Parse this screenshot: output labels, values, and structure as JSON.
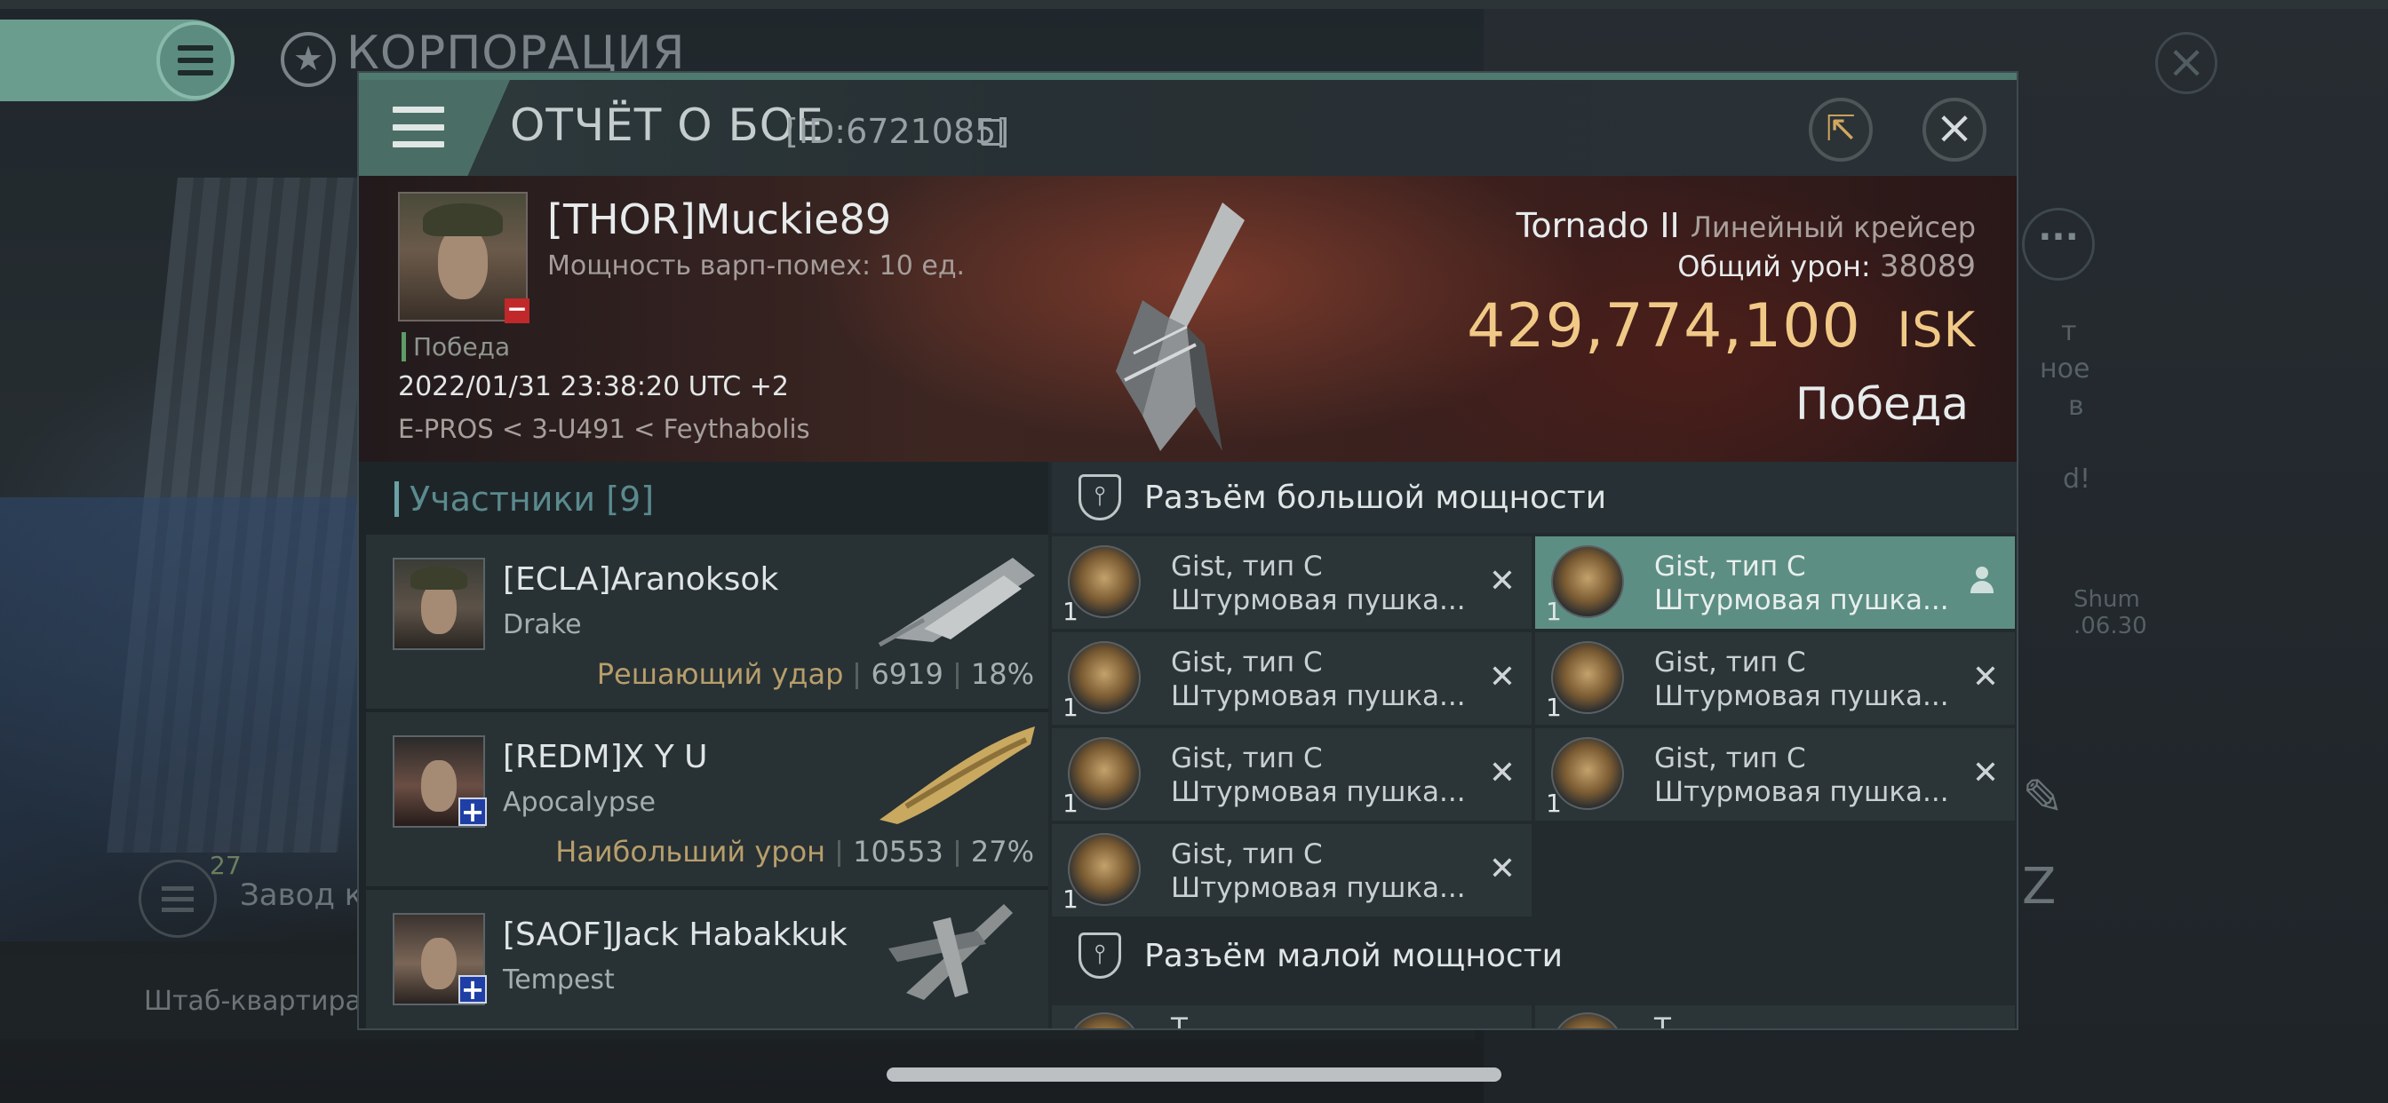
{
  "background": {
    "corp_title": "КОРПОРАЦИЯ",
    "side_lines": [
      "т",
      "ное",
      "в",
      "d!",
      "Shum",
      ".06.30"
    ],
    "factory_count": "27",
    "factory_label": "Завод к",
    "hq_label": "Штаб-квартира К"
  },
  "modal": {
    "title": "ОТЧЁТ О БОЕ",
    "report_id": "[ID:6721085]",
    "share_icon": "share-icon",
    "close_icon": "close-icon"
  },
  "victim": {
    "name": "[THOR]Muckie89",
    "warp_disrupt": "Мощность варп-помех: 10 ед.",
    "outcome_small": "Победа",
    "datetime": "2022/01/31 23:38:20 UTC +2",
    "location": "E-PROS < 3-U491 < Feythabolis",
    "ship_name": "Tornado II",
    "ship_class": "Линейный крейсер",
    "total_damage_label": "Общий урон:",
    "total_damage": "38089",
    "isk_value": "429,774,100",
    "isk_unit": "ISK",
    "outcome_big": "Победа"
  },
  "participants": {
    "title": "Участники [9]",
    "items": [
      {
        "name": "[ECLA]Aranoksok",
        "ship": "Drake",
        "tag": "Решающий удар",
        "damage": "6919",
        "percent": "18%"
      },
      {
        "name": "[REDM]X Y U",
        "ship": "Apocalypse",
        "tag": "Наибольший урон",
        "damage": "10553",
        "percent": "27%"
      },
      {
        "name": "[SAOF]Jack Habakkuk",
        "ship": "Tempest",
        "tag": "",
        "damage": "",
        "percent": ""
      }
    ]
  },
  "fitting": {
    "high_slot_title": "Разъём большой мощности",
    "low_slot_title": "Разъём малой мощности",
    "high_modules": [
      {
        "name": "Gist, тип C",
        "type": "Штурмовая пушка...",
        "qty": "1"
      },
      {
        "name": "Gist, тип C",
        "type": "Штурмовая пушка...",
        "qty": "1"
      },
      {
        "name": "Gist, тип C",
        "type": "Штурмовая пушка...",
        "qty": "1"
      },
      {
        "name": "Gist, тип C",
        "type": "Штурмовая пушка...",
        "qty": "1"
      },
      {
        "name": "Gist, тип C",
        "type": "Штурмовая пушка...",
        "qty": "1"
      },
      {
        "name": "Gist, тип C",
        "type": "Штурмовая пушка...",
        "qty": "1"
      },
      {
        "name": "Gist, тип C",
        "type": "Штурмовая пушка...",
        "qty": "1"
      }
    ],
    "low_modules_partial": [
      {
        "name": "T"
      },
      {
        "name": "T"
      }
    ]
  },
  "colors": {
    "accent_teal": "#5d8e83",
    "isk_gold": "#f1c987",
    "tag_gold": "#b79e6b",
    "loss_red": "#c0282a",
    "ally_blue": "#1f3fa6"
  }
}
